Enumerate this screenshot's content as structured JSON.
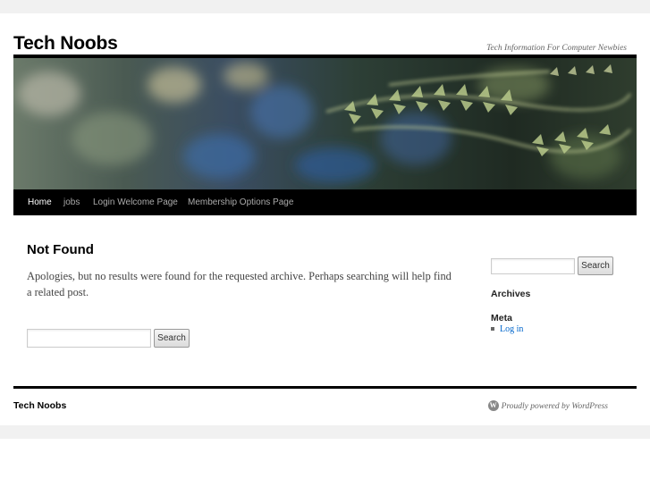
{
  "site": {
    "title": "Tech Noobs",
    "description": "Tech Information For Computer Newbies"
  },
  "nav": {
    "items": [
      {
        "label": "Home",
        "active": true
      },
      {
        "label": "jobs",
        "active": false
      },
      {
        "label": "Login Welcome Page",
        "active": false
      },
      {
        "label": "Membership Options Page",
        "active": false
      }
    ]
  },
  "content": {
    "title": "Not Found",
    "message": "Apologies, but no results were found for the requested archive. Perhaps searching will help find a related post.",
    "search_button": "Search",
    "search_value": ""
  },
  "sidebar": {
    "search_button": "Search",
    "search_value": "",
    "archives_title": "Archives",
    "meta_title": "Meta",
    "meta_items": [
      "Log in"
    ]
  },
  "footer": {
    "title": "Tech Noobs",
    "powered_by": "Proudly powered by WordPress"
  },
  "colors": {
    "nav_bg": "#000000",
    "link": "#0066cc",
    "band": "#f1f1f1"
  }
}
